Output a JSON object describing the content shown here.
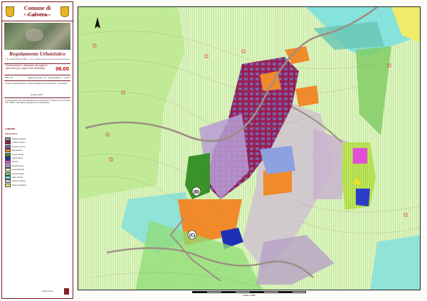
{
  "panel": {
    "municipality": "Comune di Calvera",
    "province": "Provincia di Potenza",
    "plan_title": "Regolamento Urbanistico",
    "legal_reference": "L.R. 11 AGOSTO 1999, n. 23 - Tutela, Governo ed Uso del Territorio",
    "sheet_description": "Perimetrazione e definizione dei regimi di intervento (con regimi d'uso territoriale)",
    "sheet_number": "06.00",
    "meta_left": "REV. 00",
    "meta_mid": "Aggiornamento: 1.0",
    "scale_label": "Scala grafica: 1 : 1.000",
    "designers": "Gruppo di progettazione · Responsabile del procedimento · Consulenti",
    "date": "Giugno 2007",
    "notes": "Legenda delle zone del Regolamento Urbanistico di Calvera ai sensi della L.R. 23/99 e del relativo regolamento di attuazione.",
    "designer_mark": "Studio tecnico"
  },
  "legend": {
    "title": "Legenda",
    "subtitle": "Infrastrutture",
    "items": [
      {
        "label": "Strade esistenti",
        "color": "#9c8f84"
      },
      {
        "label": "Ambito urbano",
        "color": "#9a1d50"
      },
      {
        "label": "Tessuto storico",
        "color": "#7b5ea8"
      },
      {
        "label": "Espansione",
        "color": "#f08a2a"
      },
      {
        "label": "Verde urbano",
        "color": "#3e9b2e"
      },
      {
        "label": "Attrezzature",
        "color": "#1e2fb8"
      },
      {
        "label": "Servizi",
        "color": "#e24fd7"
      },
      {
        "label": "Residenziale",
        "color": "#b79cd3"
      },
      {
        "label": "Zona agricola",
        "color": "#dff5c2"
      },
      {
        "label": "Area boscata",
        "color": "#7dcb62"
      },
      {
        "label": "Aree idriche",
        "color": "#79dfe2"
      },
      {
        "label": "Area di rispetto",
        "color": "#d7d1d4"
      },
      {
        "label": "Zona produttiva",
        "color": "#f0eb69"
      }
    ]
  },
  "map": {
    "marker_b": "(B)",
    "marker_c": "(C)",
    "scale_text": "Scala 1:1000"
  }
}
